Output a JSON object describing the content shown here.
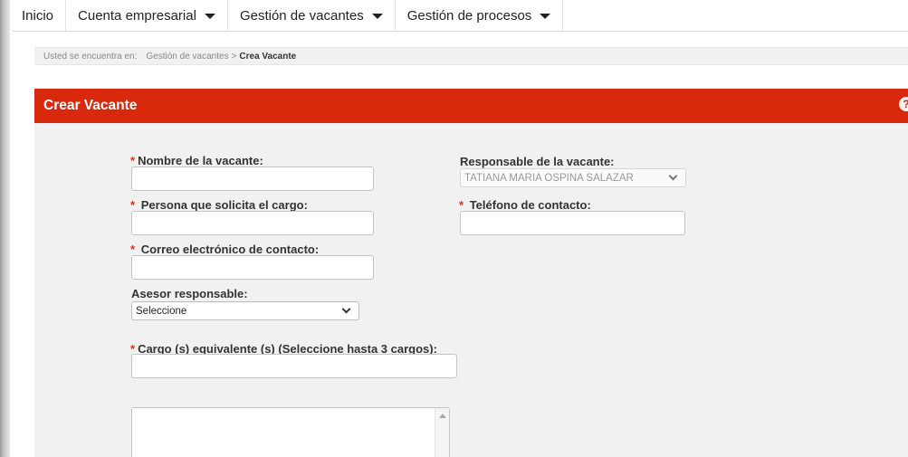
{
  "nav": {
    "items": [
      {
        "label": "Inicio",
        "has_dropdown": false
      },
      {
        "label": "Cuenta empresarial",
        "has_dropdown": true
      },
      {
        "label": "Gestión de vacantes",
        "has_dropdown": true
      },
      {
        "label": "Gestión de procesos",
        "has_dropdown": true
      }
    ]
  },
  "breadcrumb": {
    "prefix": "Usted se encuentra en:",
    "parent": "Gestión de vacantes",
    "separator": ">",
    "current": "Crea Vacante"
  },
  "panel": {
    "title": "Crear Vacante",
    "help_icon": "help-icon",
    "accent_color": "#d9290c"
  },
  "form": {
    "required_marker": "*",
    "nombre_vacante": {
      "label": "Nombre de la vacante:",
      "value": "",
      "required": true
    },
    "persona_solicita": {
      "label": "Persona que solicita el cargo:",
      "value": "",
      "required": true
    },
    "correo_contacto": {
      "label": "Correo electrónico de contacto:",
      "value": "",
      "required": true
    },
    "asesor_responsable": {
      "label": "Asesor responsable:",
      "selected": "Seleccione",
      "required": false
    },
    "cargo_equivalente": {
      "label": "Cargo (s) equivalente (s) (Seleccione hasta 3 cargos):",
      "value": "",
      "required": true
    },
    "responsable_vacante": {
      "label": "Responsable de la vacante:",
      "selected": "TATIANA MARIA OSPINA SALAZAR",
      "disabled": true
    },
    "telefono_contacto": {
      "label": "Teléfono de contacto:",
      "value": "",
      "required": true
    },
    "cargos_list": {
      "value": ""
    }
  }
}
